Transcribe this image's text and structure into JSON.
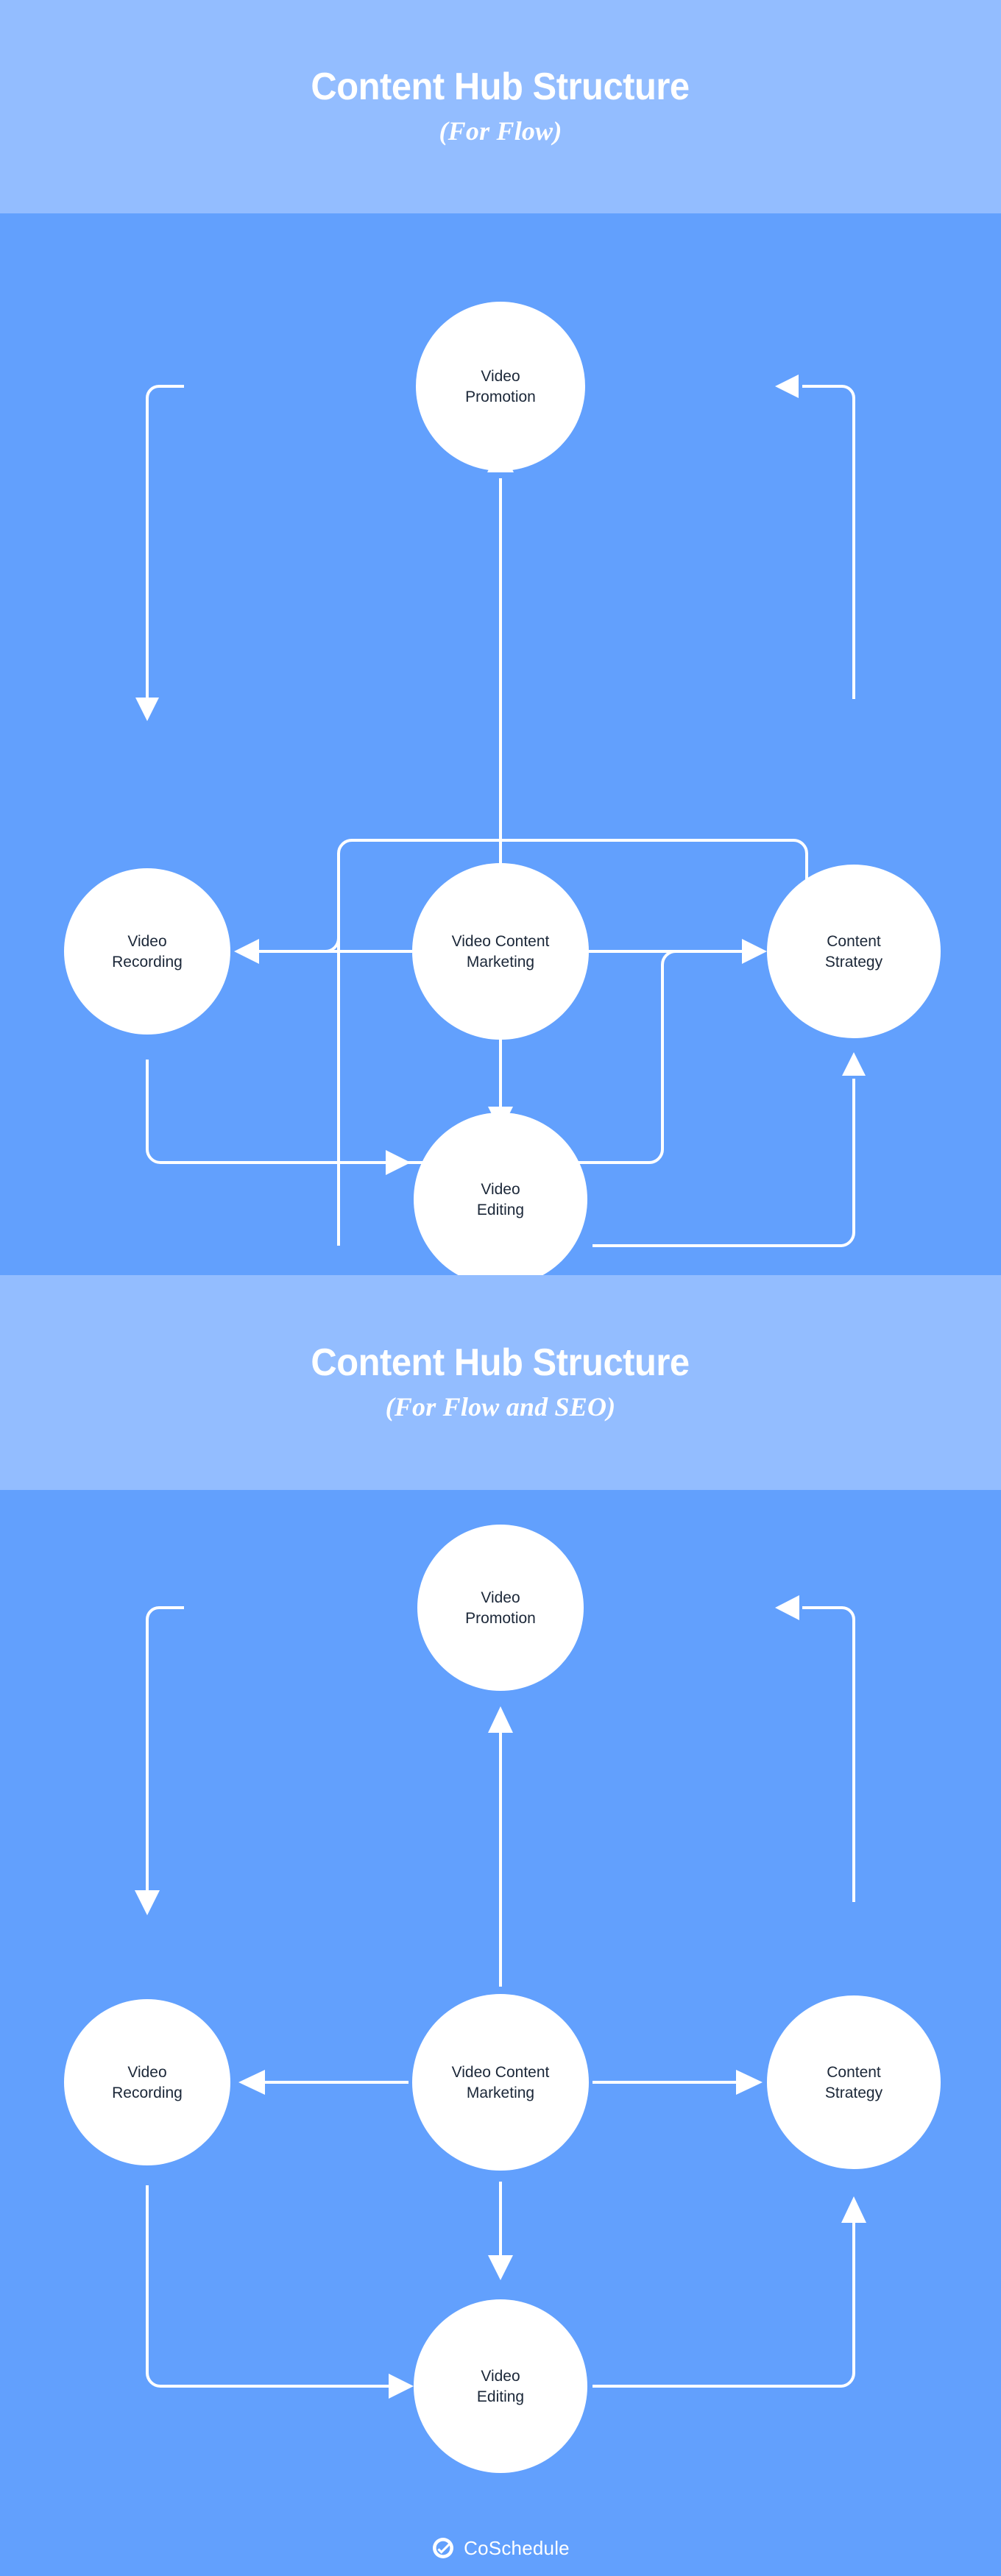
{
  "sections": [
    {
      "title": "Content Hub Structure",
      "subtitle": "(For Flow)",
      "nodes": {
        "top": "Video\nPromotion",
        "top_line1": "Video",
        "top_line2": "Promotion",
        "left_line1": "Video",
        "left_line2": "Recording",
        "center_line1": "Video Content",
        "center_line2": "Marketing",
        "right_line1": "Content",
        "right_line2": "Strategy",
        "bottom_line1": "Video",
        "bottom_line2": "Editing"
      }
    },
    {
      "title": "Content Hub Structure",
      "subtitle": "(For Flow and SEO)",
      "nodes": {
        "top_line1": "Video",
        "top_line2": "Promotion",
        "left_line1": "Video",
        "left_line2": "Recording",
        "center_line1": "Video Content",
        "center_line2": "Marketing",
        "right_line1": "Content",
        "right_line2": "Strategy",
        "bottom_line1": "Video",
        "bottom_line2": "Editing"
      }
    }
  ],
  "footer": {
    "brand": "CoSchedule",
    "logo_icon": "check-circle-icon"
  },
  "colors": {
    "band_background": "#93bdff",
    "body_background": "#62a0fd",
    "node_fill": "#ffffff",
    "node_text": "#1b2738",
    "connector": "#ffffff",
    "title_text": "#ffffff"
  },
  "chart_data": {
    "type": "diagram",
    "title": "Content Hub Structure",
    "diagrams": [
      {
        "name": "For Flow",
        "nodes": [
          "Video Promotion",
          "Video Recording",
          "Video Content Marketing",
          "Content Strategy",
          "Video Editing"
        ],
        "edges": [
          {
            "from": "Video Promotion",
            "to": "Video Recording"
          },
          {
            "from": "Video Content Marketing",
            "to": "Video Promotion"
          },
          {
            "from": "Video Content Marketing",
            "to": "Video Recording"
          },
          {
            "from": "Video Content Marketing",
            "to": "Content Strategy"
          },
          {
            "from": "Video Content Marketing",
            "to": "Video Editing"
          },
          {
            "from": "Content Strategy",
            "to": "Video Promotion"
          },
          {
            "from": "Content Strategy",
            "to": "Video Recording"
          },
          {
            "from": "Video Editing",
            "to": "Content Strategy"
          },
          {
            "from": "Video Recording",
            "to": "Video Editing"
          },
          {
            "from": "Video Editing",
            "to": "Video Promotion"
          }
        ]
      },
      {
        "name": "For Flow and SEO",
        "nodes": [
          "Video Promotion",
          "Video Recording",
          "Video Content Marketing",
          "Content Strategy",
          "Video Editing"
        ],
        "edges": [
          {
            "from": "Video Promotion",
            "to": "Video Recording"
          },
          {
            "from": "Video Content Marketing",
            "to": "Video Promotion"
          },
          {
            "from": "Video Content Marketing",
            "to": "Video Recording"
          },
          {
            "from": "Video Content Marketing",
            "to": "Content Strategy"
          },
          {
            "from": "Video Content Marketing",
            "to": "Video Editing"
          },
          {
            "from": "Video Recording",
            "to": "Video Editing"
          },
          {
            "from": "Video Editing",
            "to": "Content Strategy"
          },
          {
            "from": "Content Strategy",
            "to": "Video Promotion"
          }
        ]
      }
    ]
  }
}
